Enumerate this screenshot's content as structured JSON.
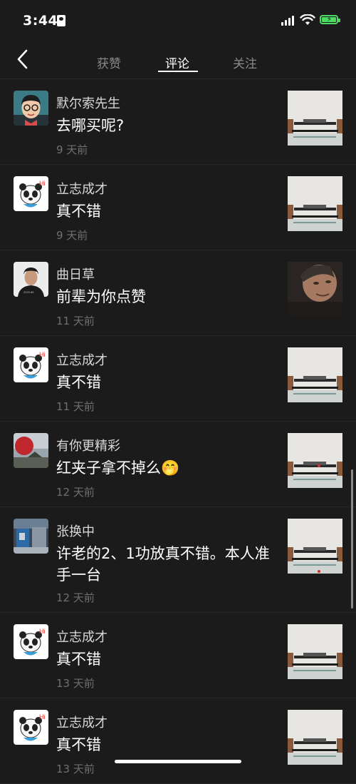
{
  "status_bar": {
    "time": "3:44"
  },
  "nav": {
    "tabs": [
      {
        "label": "获赞"
      },
      {
        "label": "评论"
      },
      {
        "label": "关注"
      }
    ],
    "active_tab": "评论"
  },
  "comments": [
    {
      "name": "默尔索先生",
      "text": "去哪买呢?",
      "time": "9 天前",
      "avatar": "cartoon-man",
      "thumb": "audio-equipment"
    },
    {
      "name": "立志成才",
      "text": "真不错",
      "time": "9 天前",
      "avatar": "panda-hi",
      "thumb": "audio-equipment"
    },
    {
      "name": "曲日草",
      "text": "前辈为你点赞",
      "time": "11 天前",
      "avatar": "man-photo",
      "thumb": "man-face"
    },
    {
      "name": "立志成才",
      "text": "真不错",
      "time": "11 天前",
      "avatar": "panda-hi",
      "thumb": "audio-equipment"
    },
    {
      "name": "有你更精彩",
      "text": "红夹子拿不掉么🤭",
      "time": "12 天前",
      "avatar": "red-lantern",
      "thumb": "audio-equipment"
    },
    {
      "name": "张换中",
      "text": "许老的2、1功放真不错。本人准手一台",
      "time": "12 天前",
      "avatar": "store-photo",
      "thumb": "audio-equipment"
    },
    {
      "name": "立志成才",
      "text": "真不错",
      "time": "13 天前",
      "avatar": "panda-hi",
      "thumb": "audio-equipment"
    },
    {
      "name": "立志成才",
      "text": "真不错",
      "time": "13 天前",
      "avatar": "panda-hi",
      "thumb": "audio-equipment"
    }
  ],
  "colors": {
    "background": "#1b1b1b",
    "battery": "#4cd964",
    "muted": "#6f6f6f"
  }
}
